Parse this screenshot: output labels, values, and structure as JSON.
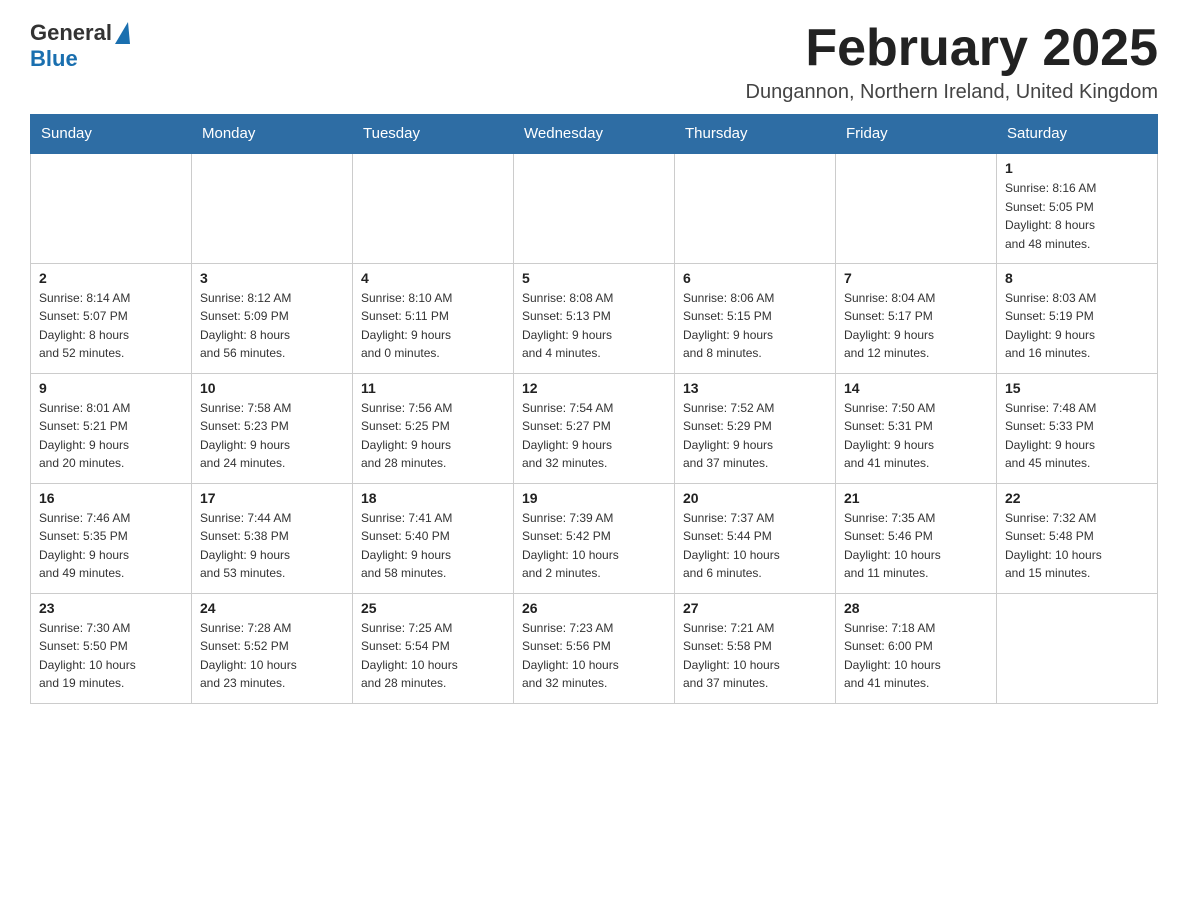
{
  "header": {
    "logo_general": "General",
    "logo_blue": "Blue",
    "title": "February 2025",
    "location": "Dungannon, Northern Ireland, United Kingdom"
  },
  "days_of_week": [
    "Sunday",
    "Monday",
    "Tuesday",
    "Wednesday",
    "Thursday",
    "Friday",
    "Saturday"
  ],
  "weeks": [
    [
      {
        "day": "",
        "info": ""
      },
      {
        "day": "",
        "info": ""
      },
      {
        "day": "",
        "info": ""
      },
      {
        "day": "",
        "info": ""
      },
      {
        "day": "",
        "info": ""
      },
      {
        "day": "",
        "info": ""
      },
      {
        "day": "1",
        "info": "Sunrise: 8:16 AM\nSunset: 5:05 PM\nDaylight: 8 hours\nand 48 minutes."
      }
    ],
    [
      {
        "day": "2",
        "info": "Sunrise: 8:14 AM\nSunset: 5:07 PM\nDaylight: 8 hours\nand 52 minutes."
      },
      {
        "day": "3",
        "info": "Sunrise: 8:12 AM\nSunset: 5:09 PM\nDaylight: 8 hours\nand 56 minutes."
      },
      {
        "day": "4",
        "info": "Sunrise: 8:10 AM\nSunset: 5:11 PM\nDaylight: 9 hours\nand 0 minutes."
      },
      {
        "day": "5",
        "info": "Sunrise: 8:08 AM\nSunset: 5:13 PM\nDaylight: 9 hours\nand 4 minutes."
      },
      {
        "day": "6",
        "info": "Sunrise: 8:06 AM\nSunset: 5:15 PM\nDaylight: 9 hours\nand 8 minutes."
      },
      {
        "day": "7",
        "info": "Sunrise: 8:04 AM\nSunset: 5:17 PM\nDaylight: 9 hours\nand 12 minutes."
      },
      {
        "day": "8",
        "info": "Sunrise: 8:03 AM\nSunset: 5:19 PM\nDaylight: 9 hours\nand 16 minutes."
      }
    ],
    [
      {
        "day": "9",
        "info": "Sunrise: 8:01 AM\nSunset: 5:21 PM\nDaylight: 9 hours\nand 20 minutes."
      },
      {
        "day": "10",
        "info": "Sunrise: 7:58 AM\nSunset: 5:23 PM\nDaylight: 9 hours\nand 24 minutes."
      },
      {
        "day": "11",
        "info": "Sunrise: 7:56 AM\nSunset: 5:25 PM\nDaylight: 9 hours\nand 28 minutes."
      },
      {
        "day": "12",
        "info": "Sunrise: 7:54 AM\nSunset: 5:27 PM\nDaylight: 9 hours\nand 32 minutes."
      },
      {
        "day": "13",
        "info": "Sunrise: 7:52 AM\nSunset: 5:29 PM\nDaylight: 9 hours\nand 37 minutes."
      },
      {
        "day": "14",
        "info": "Sunrise: 7:50 AM\nSunset: 5:31 PM\nDaylight: 9 hours\nand 41 minutes."
      },
      {
        "day": "15",
        "info": "Sunrise: 7:48 AM\nSunset: 5:33 PM\nDaylight: 9 hours\nand 45 minutes."
      }
    ],
    [
      {
        "day": "16",
        "info": "Sunrise: 7:46 AM\nSunset: 5:35 PM\nDaylight: 9 hours\nand 49 minutes."
      },
      {
        "day": "17",
        "info": "Sunrise: 7:44 AM\nSunset: 5:38 PM\nDaylight: 9 hours\nand 53 minutes."
      },
      {
        "day": "18",
        "info": "Sunrise: 7:41 AM\nSunset: 5:40 PM\nDaylight: 9 hours\nand 58 minutes."
      },
      {
        "day": "19",
        "info": "Sunrise: 7:39 AM\nSunset: 5:42 PM\nDaylight: 10 hours\nand 2 minutes."
      },
      {
        "day": "20",
        "info": "Sunrise: 7:37 AM\nSunset: 5:44 PM\nDaylight: 10 hours\nand 6 minutes."
      },
      {
        "day": "21",
        "info": "Sunrise: 7:35 AM\nSunset: 5:46 PM\nDaylight: 10 hours\nand 11 minutes."
      },
      {
        "day": "22",
        "info": "Sunrise: 7:32 AM\nSunset: 5:48 PM\nDaylight: 10 hours\nand 15 minutes."
      }
    ],
    [
      {
        "day": "23",
        "info": "Sunrise: 7:30 AM\nSunset: 5:50 PM\nDaylight: 10 hours\nand 19 minutes."
      },
      {
        "day": "24",
        "info": "Sunrise: 7:28 AM\nSunset: 5:52 PM\nDaylight: 10 hours\nand 23 minutes."
      },
      {
        "day": "25",
        "info": "Sunrise: 7:25 AM\nSunset: 5:54 PM\nDaylight: 10 hours\nand 28 minutes."
      },
      {
        "day": "26",
        "info": "Sunrise: 7:23 AM\nSunset: 5:56 PM\nDaylight: 10 hours\nand 32 minutes."
      },
      {
        "day": "27",
        "info": "Sunrise: 7:21 AM\nSunset: 5:58 PM\nDaylight: 10 hours\nand 37 minutes."
      },
      {
        "day": "28",
        "info": "Sunrise: 7:18 AM\nSunset: 6:00 PM\nDaylight: 10 hours\nand 41 minutes."
      },
      {
        "day": "",
        "info": ""
      }
    ]
  ]
}
